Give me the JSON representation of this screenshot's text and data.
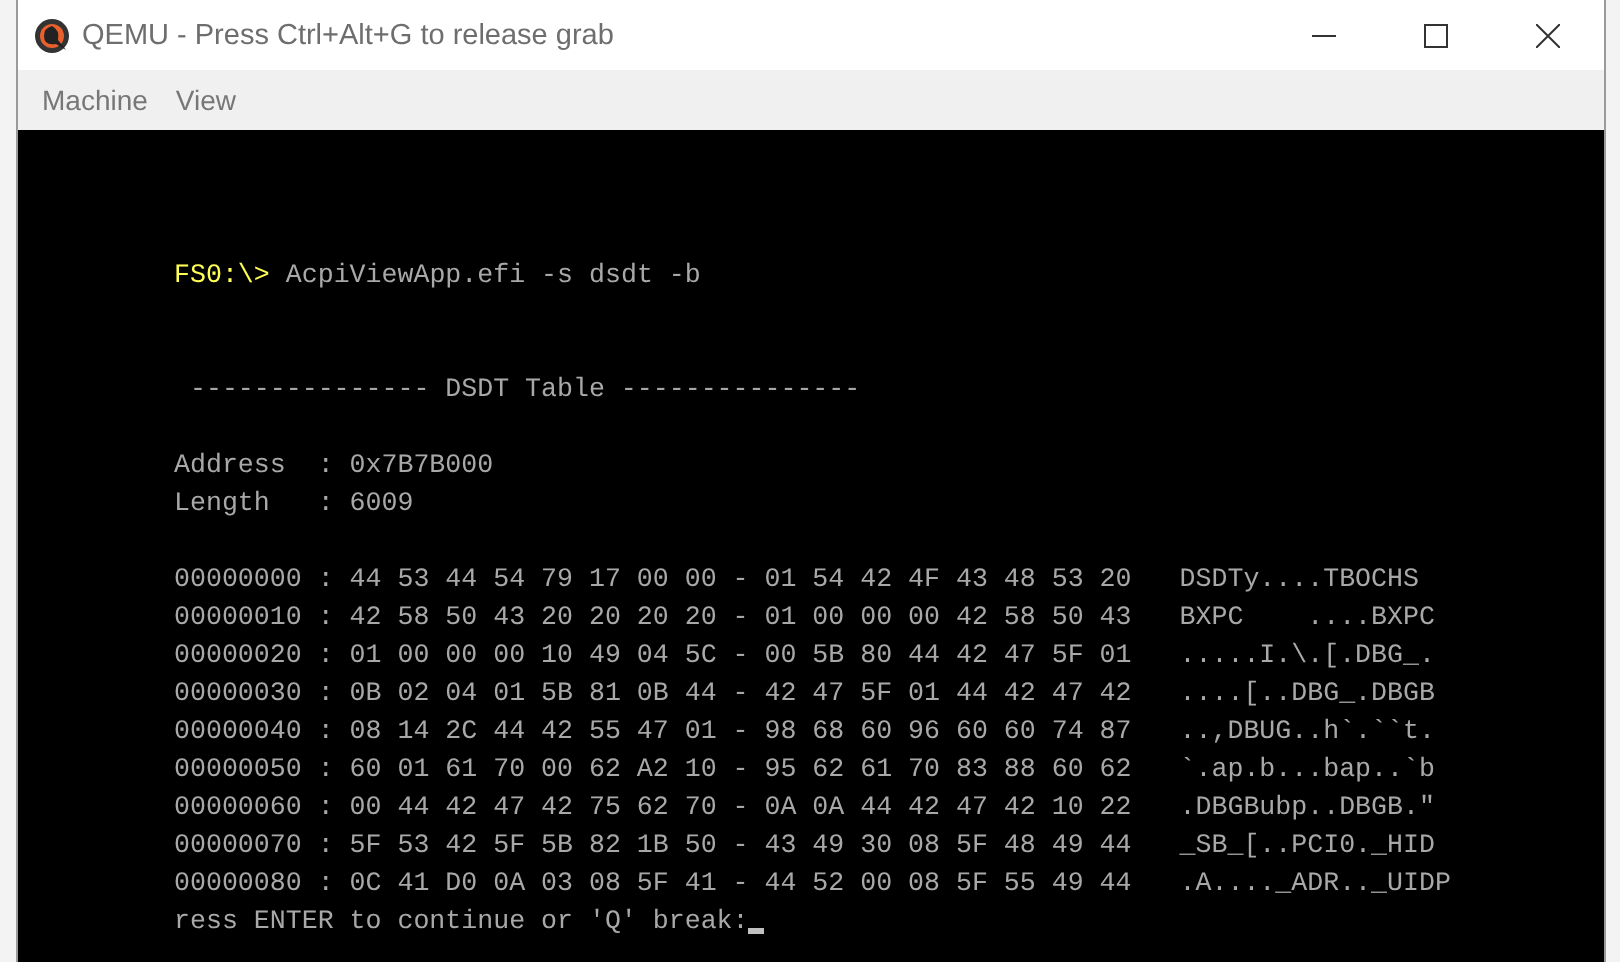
{
  "window": {
    "title": "QEMU - Press Ctrl+Alt+G to release grab"
  },
  "menu": [
    "Machine",
    "View"
  ],
  "console": {
    "lines": [
      {
        "kind": "prompt",
        "prompt": "FS0:\\>",
        "text": "AcpiViewApp.efi -s dsdt -b"
      },
      {
        "kind": "blank"
      },
      {
        "kind": "blank"
      },
      {
        "kind": "text",
        "text": " --------------- DSDT Table ---------------"
      },
      {
        "kind": "blank"
      },
      {
        "kind": "text",
        "text": "Address  : 0x7B7B000"
      },
      {
        "kind": "text",
        "text": "Length   : 6009"
      },
      {
        "kind": "blank"
      },
      {
        "kind": "hex",
        "text": "00000000 : 44 53 44 54 79 17 00 00 - 01 54 42 4F 43 48 53 20",
        "ascii": "DSDTy....TBOCHS"
      },
      {
        "kind": "hex",
        "text": "00000010 : 42 58 50 43 20 20 20 20 - 01 00 00 00 42 58 50 43",
        "ascii": "BXPC    ....BXPC"
      },
      {
        "kind": "hex",
        "text": "00000020 : 01 00 00 00 10 49 04 5C - 00 5B 80 44 42 47 5F 01",
        "ascii": ".....I.\\.[.DBG_."
      },
      {
        "kind": "hex",
        "text": "00000030 : 0B 02 04 01 5B 81 0B 44 - 42 47 5F 01 44 42 47 42",
        "ascii": "....[..DBG_.DBGB"
      },
      {
        "kind": "hex",
        "text": "00000040 : 08 14 2C 44 42 55 47 01 - 98 68 60 96 60 60 74 87",
        "ascii": "..,DBUG..h`.``t."
      },
      {
        "kind": "hex",
        "text": "00000050 : 60 01 61 70 00 62 A2 10 - 95 62 61 70 83 88 60 62",
        "ascii": "`.ap.b...bap..`b"
      },
      {
        "kind": "hex",
        "text": "00000060 : 00 44 42 47 42 75 62 70 - 0A 0A 44 42 47 42 10 22",
        "ascii": ".DBGBubp..DBGB.\""
      },
      {
        "kind": "hex",
        "text": "00000070 : 5F 53 42 5F 5B 82 1B 50 - 43 49 30 08 5F 48 49 44",
        "ascii": "_SB_[..PCI0._HID"
      },
      {
        "kind": "hex",
        "text": "00000080 : 0C 41 D0 0A 03 08 5F 41 - 44 52 00 08 5F 55 49 44",
        "ascii": ".A...._ADR.._UIDP"
      },
      {
        "kind": "input",
        "text": "ress ENTER to continue or 'Q' break:"
      }
    ]
  }
}
